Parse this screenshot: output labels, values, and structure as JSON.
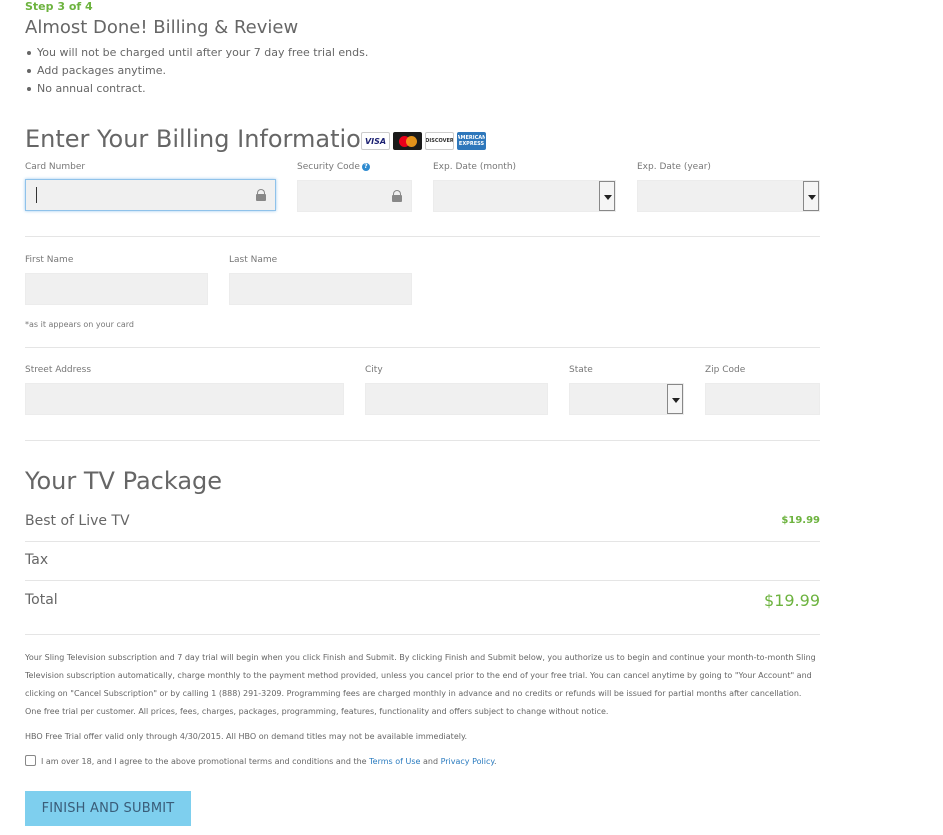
{
  "step": "Step 3 of 4",
  "heading": "Almost Done! Billing & Review",
  "bullets": [
    "You will not be charged until after your 7 day free trial ends.",
    "Add packages anytime.",
    "No annual contract."
  ],
  "billing": {
    "title": "Enter Your Billing Information",
    "cards": {
      "visa": "VISA",
      "discover": "DISCOVER",
      "amex": "AMERICAN EXPRESS"
    },
    "card_number_label": "Card Number",
    "security_code_label": "Security Code",
    "exp_month_label": "Exp. Date (month)",
    "exp_year_label": "Exp. Date (year)",
    "first_name_label": "First Name",
    "last_name_label": "Last Name",
    "name_note": "*as it appears on your card",
    "street_label": "Street Address",
    "city_label": "City",
    "state_label": "State",
    "zip_label": "Zip Code"
  },
  "package": {
    "title": "Your TV Package",
    "item_name": "Best of Live TV",
    "item_price": "$19.99",
    "tax_label": "Tax",
    "total_label": "Total",
    "total_price": "$19.99"
  },
  "legal": {
    "paragraph": "Your Sling Television subscription and 7 day trial will begin when you click Finish and Submit. By clicking Finish and Submit below, you authorize us to begin and continue your month-to-month Sling Television subscription automatically, charge monthly to the payment method provided, unless you cancel prior to the end of your free trial. You can cancel anytime by going to \"Your Account\" and clicking on \"Cancel Subscription\" or by calling 1 (888) 291-3209. Programming fees are charged monthly in advance and no credits or refunds will be issued for partial months after cancellation. One free trial per customer. All prices, fees, charges, packages, programming, features, functionality and offers subject to change without notice.",
    "hbo": "HBO Free Trial offer valid only through 4/30/2015. All HBO on demand titles may not be available immediately.",
    "agree_prefix": "I am over 18, and I agree to the above promotional terms and conditions and the ",
    "terms_link": "Terms of Use",
    "and": " and ",
    "privacy_link": "Privacy Policy",
    "agree_suffix": "."
  },
  "submit_label": "FINISH AND SUBMIT"
}
